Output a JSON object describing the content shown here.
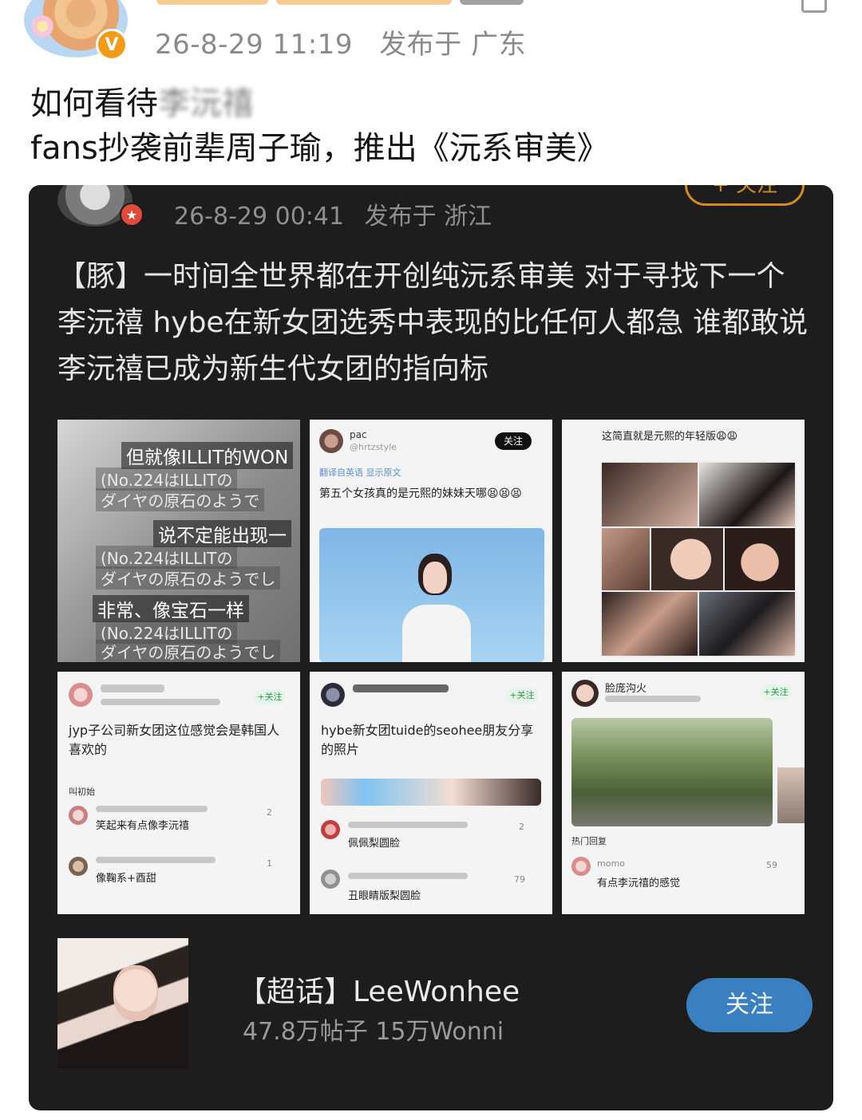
{
  "post": {
    "timestamp": "26-8-29 11:19",
    "location": "发布于 广东",
    "text_before": "如何看待",
    "text_blurred": "李沅禧",
    "text_after": "fans抄袭前辈周子瑜，推出《沅系审美》"
  },
  "embedded": {
    "timestamp": "26-8-29 00:41",
    "location": "发布于 浙江",
    "follow_label": "+ 关注",
    "text": "【豚】一时间全世界都在开创纯沅系审美  对于寻找下一个李沅禧 hybe在新女团选秀中表现的比任何人都急 谁都敢说李沅禧已成为新生代女团的指向标",
    "grid": {
      "c1": {
        "lines": [
          "但就像ILLIT的WON",
          "(No.224はILLITの",
          "ダイヤの原石のようで",
          "说不定能出现一",
          "(No.224はILLITの",
          "ダイヤの原石のようでし",
          "非常、像宝石一样",
          "(No.224はILLITの",
          "ダイヤの原石のようでし"
        ]
      },
      "c2": {
        "name": "pac",
        "handle": "@hrtzstyle",
        "follow": "关注",
        "translate": "翻译自英语  显示原文",
        "text": "第五个女孩真的是元熙的妹妹天哪😫😫😫"
      },
      "c3": {
        "caption": "这简直就是元熙的年轻版😩😩"
      },
      "c4": {
        "follow": "+关注",
        "text": "jyp子公司新女团这位感觉会是韩国人喜欢的",
        "comments_label": "叫初始",
        "comment1": "笑起来有点像李沅禧",
        "likes1": "2",
        "comment2": "像鞠系+酉甜",
        "likes2": "1"
      },
      "c5": {
        "follow": "+关注",
        "text": "hybe新女团tuide的seohee朋友分享的照片",
        "comment1": "佩佩梨圆脸",
        "likes1": "2",
        "comment2": "丑眼睛版梨圆脸",
        "likes2": "79"
      },
      "c6": {
        "name": "脸庞沟火",
        "follow": "+关注",
        "section": "热门回复",
        "commenter": "momo",
        "comment": "有点李沅禧的感觉",
        "likes": "59"
      }
    },
    "topic": {
      "title": "【超话】LeeWonhee",
      "stats": "47.8万帖子 15万Wonni",
      "follow": "关注"
    }
  }
}
